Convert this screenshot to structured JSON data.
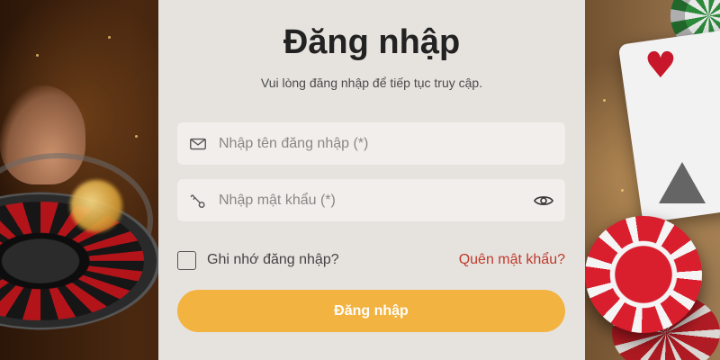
{
  "form": {
    "title": "Đăng nhập",
    "subtitle": "Vui lòng đăng nhập để tiếp tục truy cập.",
    "username": {
      "placeholder": "Nhập tên đăng nhập (*)",
      "value": "",
      "icon": "mail-icon"
    },
    "password": {
      "placeholder": "Nhập mật khẩu (*)",
      "value": "",
      "icon": "key-icon",
      "toggle_icon": "eye-icon"
    },
    "remember_label": "Ghi nhớ đăng nhập?",
    "remember_checked": false,
    "forgot_label": "Quên mật khẩu?",
    "submit_label": "Đăng nhập"
  },
  "colors": {
    "panel_bg": "#e6e3df",
    "field_bg": "#f1eeeb",
    "accent": "#f2b340",
    "forgot_link": "#c0392b",
    "title_text": "#222222"
  }
}
